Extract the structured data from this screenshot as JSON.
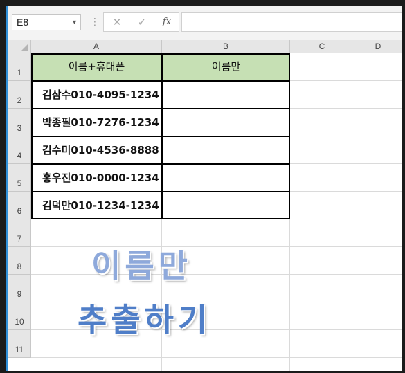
{
  "formula_bar": {
    "name_box": "E8",
    "name_box_arrow": "▼",
    "separator": "⋮",
    "cancel_glyph": "✕",
    "enter_glyph": "✓",
    "fx_label": "fx",
    "formula_value": ""
  },
  "columns": [
    "A",
    "B",
    "C",
    "D"
  ],
  "rows": [
    "1",
    "2",
    "3",
    "4",
    "5",
    "6",
    "7",
    "8",
    "9",
    "10",
    "11"
  ],
  "table": {
    "headers": [
      "이름+휴대폰",
      "이름만"
    ],
    "data": [
      [
        "김삼수010-4095-1234",
        ""
      ],
      [
        "박종필010-7276-1234",
        ""
      ],
      [
        "김수미010-4536-8888",
        ""
      ],
      [
        "홍우진010-0000-1234",
        ""
      ],
      [
        "김덕만010-1234-1234",
        ""
      ]
    ],
    "header_fill": "#c6e0b4"
  },
  "overlay": {
    "line1": "이름만",
    "line2": "추출하기",
    "color1": "#8ea9db",
    "color2": "#4f7ec8"
  },
  "icons": {
    "dropdown": "chevron-down-icon",
    "cancel": "cancel-icon",
    "enter": "check-icon",
    "function": "fx-icon",
    "select_all": "select-all-icon"
  }
}
